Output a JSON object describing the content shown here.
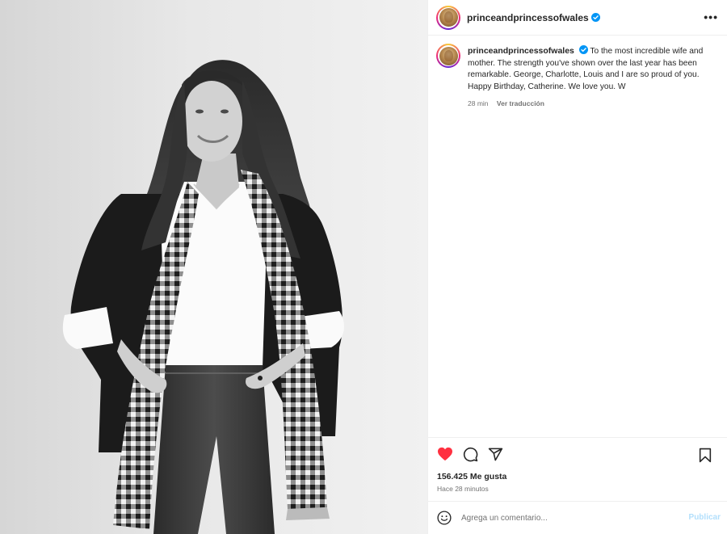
{
  "post": {
    "username": "princeandprincessofwales",
    "verified": true,
    "more_icon": "more-horizontal-icon",
    "caption": "To the most incredible wife and mother. The strength you've shown over the last year has been remarkable. George, Charlotte, Louis and I are so proud of you. Happy Birthday, Catherine. We love you. W",
    "caption_time": "28 min",
    "translate_label": "Ver traducción",
    "likes": "156.425 Me gusta",
    "posted_ago": "Hace 28 minutos",
    "liked": true
  },
  "actions": {
    "like_icon": "heart-filled-icon",
    "comment_icon": "comment-icon",
    "share_icon": "send-icon",
    "save_icon": "bookmark-icon"
  },
  "comment_box": {
    "placeholder": "Agrega un comentario...",
    "emoji_icon": "emoji-icon",
    "publish_label": "Publicar"
  },
  "colors": {
    "like_red": "#ff3040",
    "verified_blue": "#0095f6",
    "publish_disabled": "#b2dffc"
  }
}
